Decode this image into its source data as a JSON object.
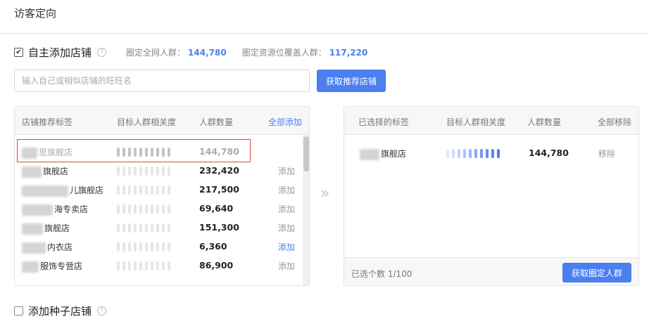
{
  "page": {
    "title": "访客定向"
  },
  "self_add": {
    "label": "自主添加店铺",
    "checked": true,
    "stats": [
      {
        "label": "圈定全网人群：",
        "value": "144,780"
      },
      {
        "label": "圈定资源位覆盖人群：",
        "value": "117,220"
      }
    ]
  },
  "search": {
    "placeholder": "输入自己或相似店铺的旺旺名",
    "value": ""
  },
  "fetch_button": {
    "label": "获取推荐店铺"
  },
  "left_table": {
    "headers": [
      "店铺推荐标签",
      "目标人群相关度",
      "人群数量",
      "全部添加"
    ],
    "rows": [
      {
        "name": "思旗舰店",
        "count": "144,780",
        "action": "",
        "relevance_bars": 10,
        "added": true
      },
      {
        "name": "旗舰店",
        "count": "232,420",
        "action": "添加",
        "relevance_bars": 10,
        "added": false
      },
      {
        "name": "儿旗舰店",
        "count": "217,500",
        "action": "添加",
        "relevance_bars": 10,
        "added": false
      },
      {
        "name": "海专卖店",
        "count": "69,640",
        "action": "添加",
        "relevance_bars": 10,
        "added": false
      },
      {
        "name": "旗舰店",
        "count": "151,300",
        "action": "添加",
        "relevance_bars": 10,
        "added": false
      },
      {
        "name": "内衣店",
        "count": "6,360",
        "action": "添加",
        "relevance_bars": 10,
        "added": false,
        "action_active": true
      },
      {
        "name": "服饰专营店",
        "count": "86,900",
        "action": "添加",
        "relevance_bars": 10,
        "added": false
      }
    ]
  },
  "transfer_arrow": "»",
  "right_table": {
    "headers": [
      "已选择的标签",
      "目标人群相关度",
      "人群数量",
      "全部移除"
    ],
    "rows": [
      {
        "name": "旗舰店",
        "count": "144,780",
        "action": "移除",
        "relevance_bars": 10
      }
    ],
    "footer_count": "已选个数 1/100",
    "footer_button": "获取圈定人群"
  },
  "seed": {
    "label": "添加种子店铺",
    "checked": false
  },
  "colors": {
    "accent": "#4b7ff0",
    "highlight": "#e0443b"
  }
}
